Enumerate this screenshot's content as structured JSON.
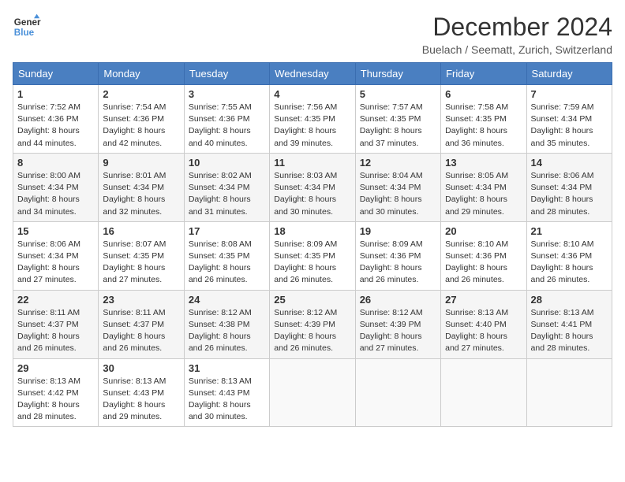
{
  "header": {
    "logo_line1": "General",
    "logo_line2": "Blue",
    "month_title": "December 2024",
    "location": "Buelach / Seematt, Zurich, Switzerland"
  },
  "days_of_week": [
    "Sunday",
    "Monday",
    "Tuesday",
    "Wednesday",
    "Thursday",
    "Friday",
    "Saturday"
  ],
  "weeks": [
    [
      {
        "day": "1",
        "sunrise": "7:52 AM",
        "sunset": "4:36 PM",
        "daylight": "8 hours and 44 minutes."
      },
      {
        "day": "2",
        "sunrise": "7:54 AM",
        "sunset": "4:36 PM",
        "daylight": "8 hours and 42 minutes."
      },
      {
        "day": "3",
        "sunrise": "7:55 AM",
        "sunset": "4:36 PM",
        "daylight": "8 hours and 40 minutes."
      },
      {
        "day": "4",
        "sunrise": "7:56 AM",
        "sunset": "4:35 PM",
        "daylight": "8 hours and 39 minutes."
      },
      {
        "day": "5",
        "sunrise": "7:57 AM",
        "sunset": "4:35 PM",
        "daylight": "8 hours and 37 minutes."
      },
      {
        "day": "6",
        "sunrise": "7:58 AM",
        "sunset": "4:35 PM",
        "daylight": "8 hours and 36 minutes."
      },
      {
        "day": "7",
        "sunrise": "7:59 AM",
        "sunset": "4:34 PM",
        "daylight": "8 hours and 35 minutes."
      }
    ],
    [
      {
        "day": "8",
        "sunrise": "8:00 AM",
        "sunset": "4:34 PM",
        "daylight": "8 hours and 34 minutes."
      },
      {
        "day": "9",
        "sunrise": "8:01 AM",
        "sunset": "4:34 PM",
        "daylight": "8 hours and 32 minutes."
      },
      {
        "day": "10",
        "sunrise": "8:02 AM",
        "sunset": "4:34 PM",
        "daylight": "8 hours and 31 minutes."
      },
      {
        "day": "11",
        "sunrise": "8:03 AM",
        "sunset": "4:34 PM",
        "daylight": "8 hours and 30 minutes."
      },
      {
        "day": "12",
        "sunrise": "8:04 AM",
        "sunset": "4:34 PM",
        "daylight": "8 hours and 30 minutes."
      },
      {
        "day": "13",
        "sunrise": "8:05 AM",
        "sunset": "4:34 PM",
        "daylight": "8 hours and 29 minutes."
      },
      {
        "day": "14",
        "sunrise": "8:06 AM",
        "sunset": "4:34 PM",
        "daylight": "8 hours and 28 minutes."
      }
    ],
    [
      {
        "day": "15",
        "sunrise": "8:06 AM",
        "sunset": "4:34 PM",
        "daylight": "8 hours and 27 minutes."
      },
      {
        "day": "16",
        "sunrise": "8:07 AM",
        "sunset": "4:35 PM",
        "daylight": "8 hours and 27 minutes."
      },
      {
        "day": "17",
        "sunrise": "8:08 AM",
        "sunset": "4:35 PM",
        "daylight": "8 hours and 26 minutes."
      },
      {
        "day": "18",
        "sunrise": "8:09 AM",
        "sunset": "4:35 PM",
        "daylight": "8 hours and 26 minutes."
      },
      {
        "day": "19",
        "sunrise": "8:09 AM",
        "sunset": "4:36 PM",
        "daylight": "8 hours and 26 minutes."
      },
      {
        "day": "20",
        "sunrise": "8:10 AM",
        "sunset": "4:36 PM",
        "daylight": "8 hours and 26 minutes."
      },
      {
        "day": "21",
        "sunrise": "8:10 AM",
        "sunset": "4:36 PM",
        "daylight": "8 hours and 26 minutes."
      }
    ],
    [
      {
        "day": "22",
        "sunrise": "8:11 AM",
        "sunset": "4:37 PM",
        "daylight": "8 hours and 26 minutes."
      },
      {
        "day": "23",
        "sunrise": "8:11 AM",
        "sunset": "4:37 PM",
        "daylight": "8 hours and 26 minutes."
      },
      {
        "day": "24",
        "sunrise": "8:12 AM",
        "sunset": "4:38 PM",
        "daylight": "8 hours and 26 minutes."
      },
      {
        "day": "25",
        "sunrise": "8:12 AM",
        "sunset": "4:39 PM",
        "daylight": "8 hours and 26 minutes."
      },
      {
        "day": "26",
        "sunrise": "8:12 AM",
        "sunset": "4:39 PM",
        "daylight": "8 hours and 27 minutes."
      },
      {
        "day": "27",
        "sunrise": "8:13 AM",
        "sunset": "4:40 PM",
        "daylight": "8 hours and 27 minutes."
      },
      {
        "day": "28",
        "sunrise": "8:13 AM",
        "sunset": "4:41 PM",
        "daylight": "8 hours and 28 minutes."
      }
    ],
    [
      {
        "day": "29",
        "sunrise": "8:13 AM",
        "sunset": "4:42 PM",
        "daylight": "8 hours and 28 minutes."
      },
      {
        "day": "30",
        "sunrise": "8:13 AM",
        "sunset": "4:43 PM",
        "daylight": "8 hours and 29 minutes."
      },
      {
        "day": "31",
        "sunrise": "8:13 AM",
        "sunset": "4:43 PM",
        "daylight": "8 hours and 30 minutes."
      },
      null,
      null,
      null,
      null
    ]
  ]
}
